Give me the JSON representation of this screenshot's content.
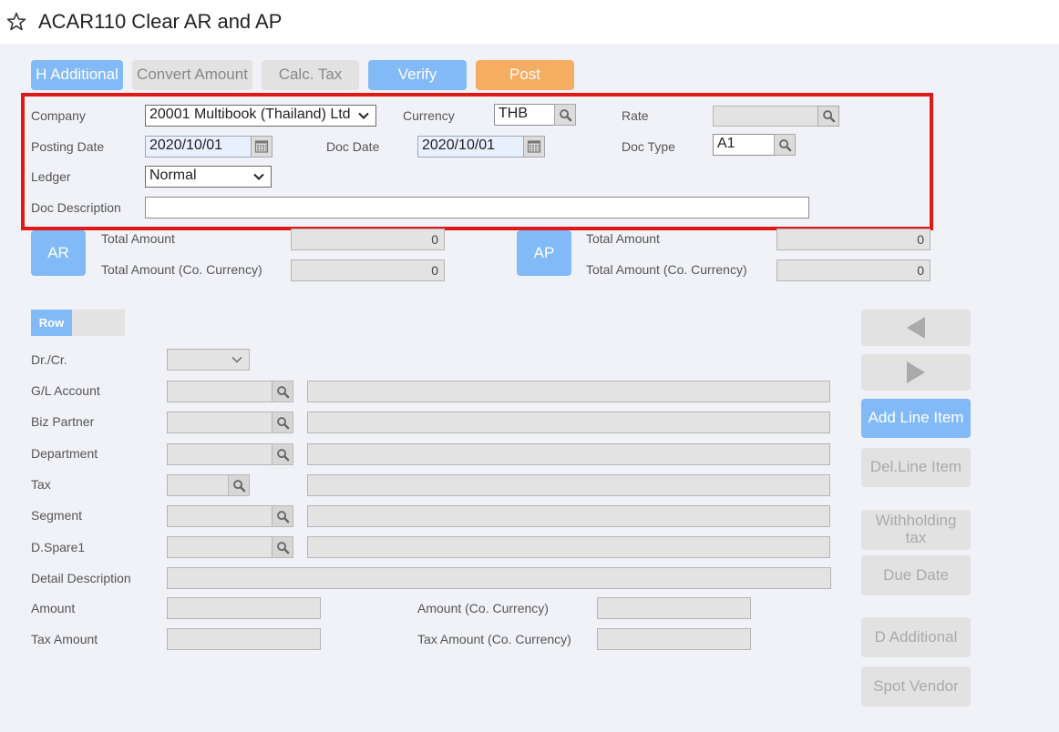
{
  "header": {
    "title": "ACAR110 Clear AR and AP"
  },
  "toolbar": {
    "h_additional": "H Additional",
    "convert_amount": "Convert Amount",
    "calc_tax": "Calc. Tax",
    "verify": "Verify",
    "post": "Post"
  },
  "form": {
    "company_label": "Company",
    "company_value": "20001 Multibook (Thailand) Ltd",
    "currency_label": "Currency",
    "currency_value": "THB",
    "rate_label": "Rate",
    "rate_value": "",
    "posting_date_label": "Posting Date",
    "posting_date_value": "2020/10/01",
    "doc_date_label": "Doc Date",
    "doc_date_value": "2020/10/01",
    "doc_type_label": "Doc Type",
    "doc_type_value": "A1",
    "ledger_label": "Ledger",
    "ledger_value": "Normal",
    "doc_description_label": "Doc Description",
    "doc_description_value": ""
  },
  "totals": {
    "ar_label": "AR",
    "ap_label": "AP",
    "total_amount_label": "Total Amount",
    "total_amount_co_label": "Total Amount (Co. Currency)",
    "ar_total": "0",
    "ar_total_co": "0",
    "ap_total": "0",
    "ap_total_co": "0"
  },
  "row_section": {
    "row_tab": "Row",
    "drcr_label": "Dr./Cr.",
    "gl_account_label": "G/L Account",
    "biz_partner_label": "Biz Partner",
    "department_label": "Department",
    "tax_label": "Tax",
    "segment_label": "Segment",
    "dspare1_label": "D.Spare1",
    "detail_description_label": "Detail Description",
    "amount_label": "Amount",
    "amount_co_label": "Amount (Co. Currency)",
    "tax_amount_label": "Tax Amount",
    "tax_amount_co_label": "Tax Amount (Co. Currency)"
  },
  "side_buttons": {
    "add_line_item": "Add Line Item",
    "del_line_item": "Del.Line Item",
    "withholding_tax": "Withholding tax",
    "due_date": "Due Date",
    "d_additional": "D Additional",
    "spot_vendor": "Spot Vendor"
  },
  "colors": {
    "accent_blue": "#82baf7",
    "post_orange": "#f4ad61",
    "highlight_red": "#e01818",
    "background": "#f1f2f8"
  }
}
